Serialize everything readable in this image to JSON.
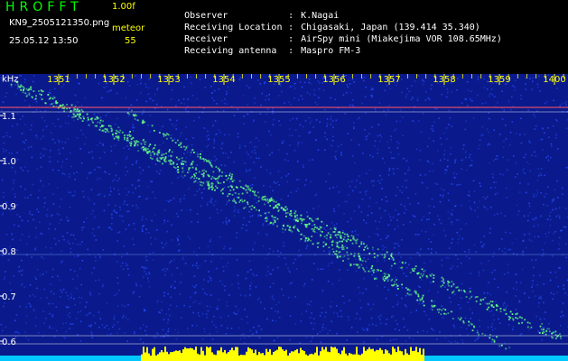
{
  "header": {
    "app_title": "HROFFT",
    "version": "1.00f",
    "filename": "KN9_2505121350.png",
    "datetime": "25.05.12 13:50",
    "meteor_label": "meteor",
    "meteor_count": "55"
  },
  "info": {
    "observer_key": "Observer",
    "observer_value": "K.Nagai",
    "location_key": "Receiving Location",
    "location_value": "Chigasaki, Japan (139.414 35.340)",
    "receiver_key": "Receiver",
    "receiver_value": "AirSpy mini (Miakejima VOR 108.65MHz)",
    "antenna_key": "Receiving antenna",
    "antenna_value": "Maspro FM-3",
    "separator": ":"
  },
  "spectrogram": {
    "unit_label": "kHz",
    "time_ticks": [
      "1351",
      "1352",
      "1353",
      "1354",
      "1355",
      "1356",
      "1357",
      "1358",
      "1359",
      "1400"
    ],
    "freq_ticks": [
      "1.1",
      "1.0",
      "0.9",
      "0.8",
      "0.7",
      "0.6"
    ],
    "colors": {
      "background": "#0a1a8c",
      "noise": "#2a4cff",
      "signal": "#66ff88",
      "tick_text": "#ffff00",
      "axis_text": "#ffffff",
      "carrier": "#ff5566",
      "bar": "#ffff00",
      "bar_base": "#00c8ff"
    }
  }
}
